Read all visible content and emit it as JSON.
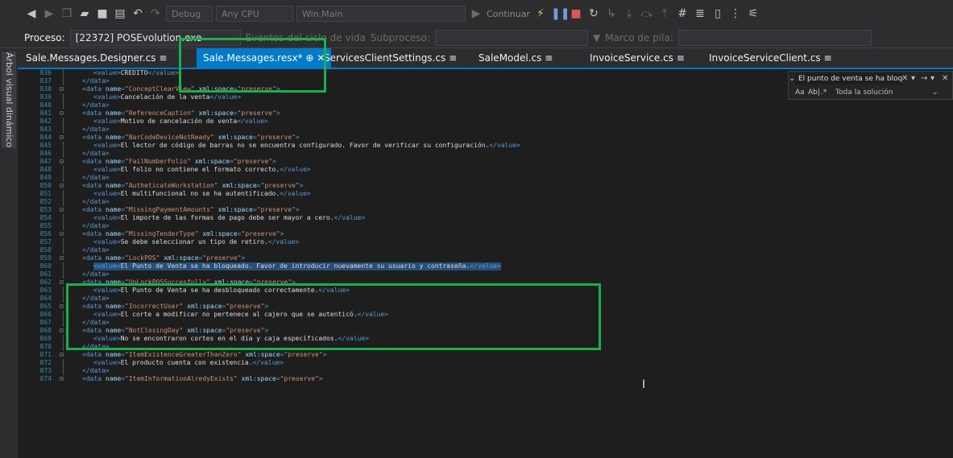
{
  "toolbar": {
    "config": "Debug",
    "platform": "Any CPU",
    "startup": "Win.Main",
    "continue": "Continuar"
  },
  "process_bar": {
    "label": "Proceso:",
    "process_value": "[22372] POSEvolution.exe",
    "lifecycle_label": "Eventos del ciclo de vida",
    "thread_label": "Subproceso:",
    "stack_label": "Marco de pila:"
  },
  "sidebar": {
    "tab": "Árbol visual dinámico"
  },
  "tabs": [
    {
      "label": "Sale.Messages.Designer.cs"
    },
    {
      "label": "Sale.Messages.resx*"
    },
    {
      "label": "ServicesClientSettings.cs"
    },
    {
      "label": "SaleModel.cs"
    },
    {
      "label": "InvoiceService.cs"
    },
    {
      "label": "InvoiceServiceClient.cs"
    }
  ],
  "find": {
    "query": "El punto de venta se ha bloqu",
    "scope": "Toda la solución",
    "match_case": "Aa",
    "whole_word": "Ab|"
  },
  "code_lines": [
    {
      "n": "836",
      "kind": "value",
      "text": "CREDITO"
    },
    {
      "n": "837",
      "kind": "close"
    },
    {
      "n": "838",
      "kind": "open",
      "name": "ConceptClearView"
    },
    {
      "n": "839",
      "kind": "value",
      "text": "Cancelación de la venta"
    },
    {
      "n": "840",
      "kind": "close"
    },
    {
      "n": "841",
      "kind": "open",
      "name": "ReferenceCaption"
    },
    {
      "n": "842",
      "kind": "value",
      "text": "Motivo de cancelación de venta"
    },
    {
      "n": "843",
      "kind": "close"
    },
    {
      "n": "844",
      "kind": "open",
      "name": "BarCodeDeviceNotReady"
    },
    {
      "n": "845",
      "kind": "value",
      "text": "El lector de código de barras no se encuentra configurado. Favor de verificar su configuración."
    },
    {
      "n": "846",
      "kind": "close"
    },
    {
      "n": "847",
      "kind": "open",
      "name": "FailNumberFolio"
    },
    {
      "n": "848",
      "kind": "value",
      "text": "El folio no contiene el formato correcto."
    },
    {
      "n": "849",
      "kind": "close"
    },
    {
      "n": "850",
      "kind": "open",
      "name": "AutheticateWorkstation"
    },
    {
      "n": "851",
      "kind": "value",
      "text": "El multifuncional no se ha autentificado."
    },
    {
      "n": "852",
      "kind": "close"
    },
    {
      "n": "853",
      "kind": "open",
      "name": "MissingPaymentAmounts"
    },
    {
      "n": "854",
      "kind": "value",
      "text": "El importe de las formas de pago debe ser mayor a cero."
    },
    {
      "n": "855",
      "kind": "close"
    },
    {
      "n": "856",
      "kind": "open",
      "name": "MissingTenderType"
    },
    {
      "n": "857",
      "kind": "value",
      "text": "Se debe seleccionar un tipo de retiro."
    },
    {
      "n": "858",
      "kind": "close"
    },
    {
      "n": "859",
      "kind": "open",
      "name": "LockPOS"
    },
    {
      "n": "860",
      "kind": "value",
      "text": "El Punto de Venta se ha bloqueado. Favor de introducir nuevamente su usuario y contraseña.",
      "selected": true
    },
    {
      "n": "861",
      "kind": "close"
    },
    {
      "n": "862",
      "kind": "open",
      "name": "UnLockPOSSuccesfully"
    },
    {
      "n": "863",
      "kind": "value",
      "text": "El Punto de Venta se ha desbloqueado correctamente."
    },
    {
      "n": "864",
      "kind": "close"
    },
    {
      "n": "865",
      "kind": "open",
      "name": "IncorrectUser"
    },
    {
      "n": "866",
      "kind": "value",
      "text": "El corte a modificar no pertenece al cajero que se autenticó."
    },
    {
      "n": "867",
      "kind": "close"
    },
    {
      "n": "868",
      "kind": "open",
      "name": "NotClosingDay"
    },
    {
      "n": "869",
      "kind": "value",
      "text": "No se encontraron cortes en el día y caja específicados."
    },
    {
      "n": "870",
      "kind": "close"
    },
    {
      "n": "871",
      "kind": "open",
      "name": "ItemExistenceGreaterThanZero"
    },
    {
      "n": "872",
      "kind": "value",
      "text": "El producto cuenta con existencia."
    },
    {
      "n": "873",
      "kind": "close"
    },
    {
      "n": "874",
      "kind": "open",
      "name": "ItemInformationAlredyExists"
    }
  ],
  "colors": {
    "accent": "#007acc",
    "highlight_box": "#16b14a"
  }
}
